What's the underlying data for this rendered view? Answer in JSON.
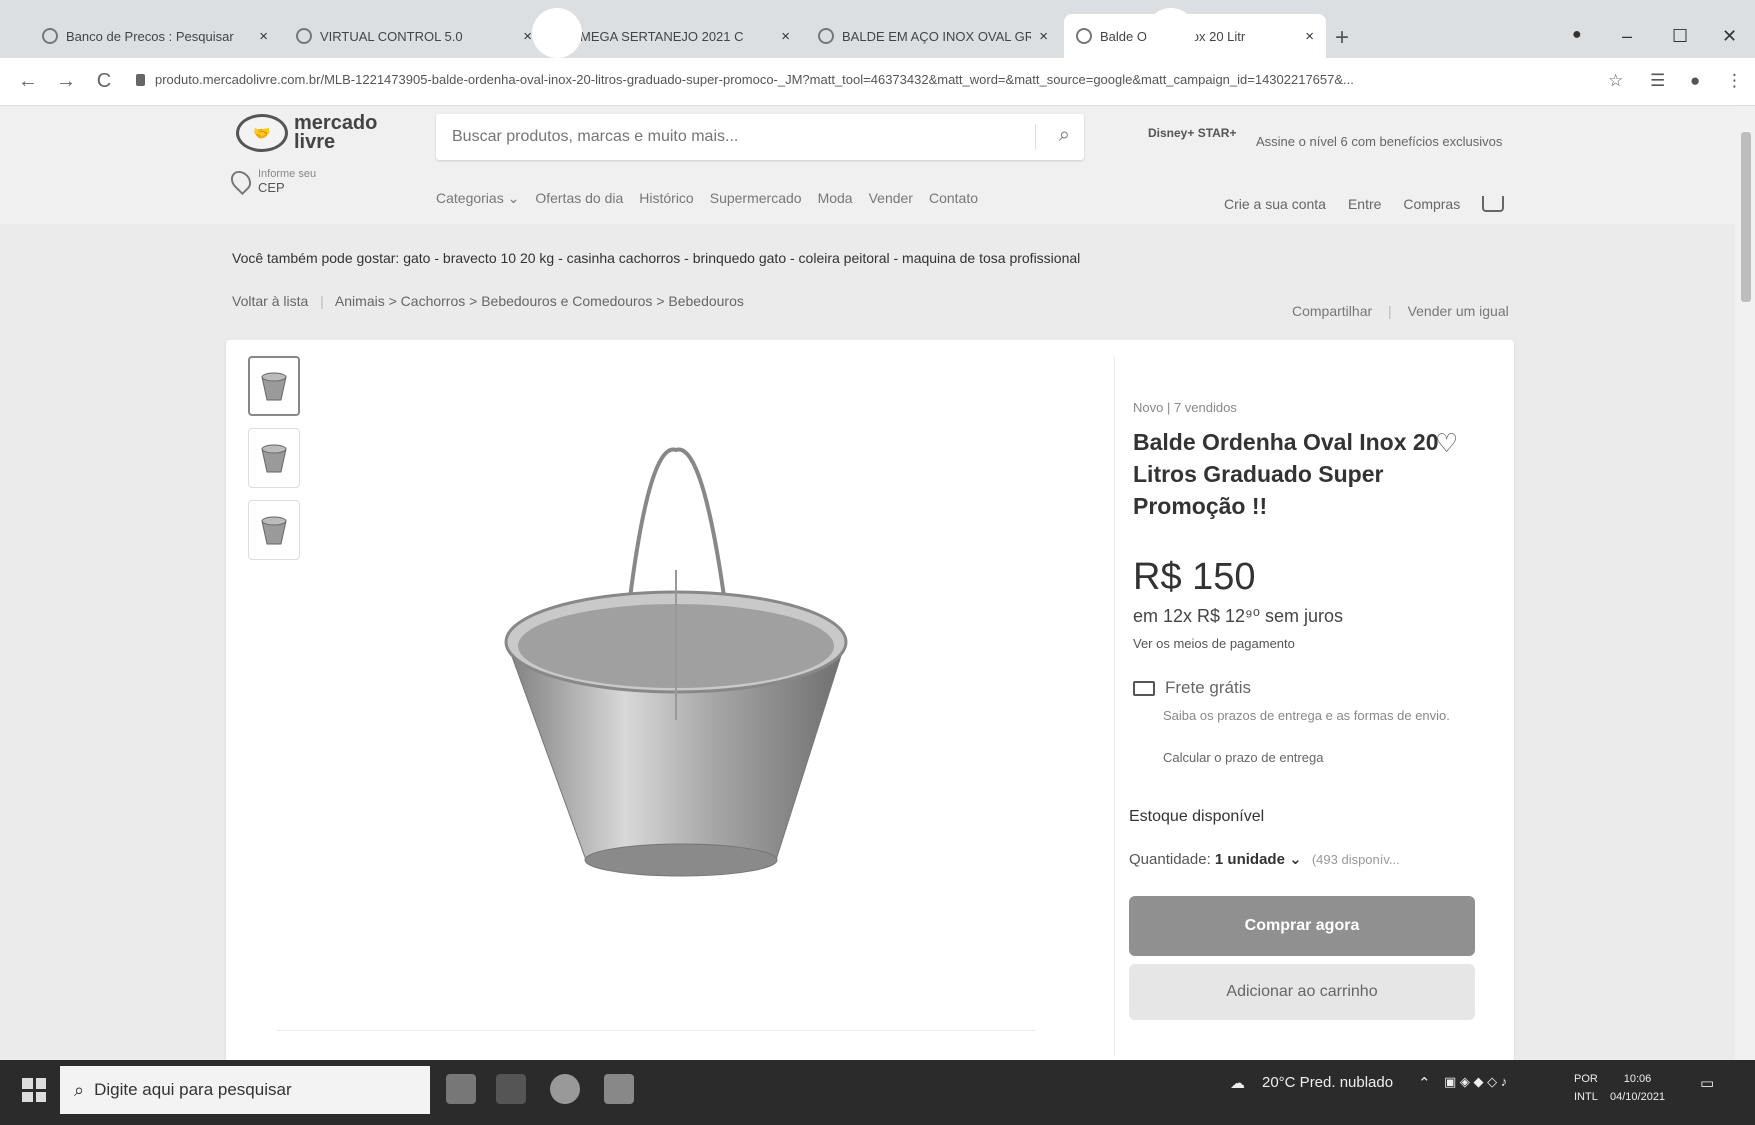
{
  "browser": {
    "tabs": [
      {
        "title": "Banco de Precos : Pesquisar",
        "close": "×"
      },
      {
        "title": "VIRTUAL CONTROL 5.0",
        "close": "×"
      },
      {
        "title": "MEGA SERTANEJO 2021 C",
        "close": "×"
      },
      {
        "title": "BALDE EM AÇO INOX OVAL GRA",
        "close": "×"
      },
      {
        "title": "Balde O    Oval Inox 20 Litr",
        "close": "×"
      }
    ],
    "new_tab": "+",
    "minimize": "–",
    "maximize": "☐",
    "close": "✕",
    "url": "produto.mercadolivre.com.br/MLB-1221473905-balde-ordenha-oval-inox-20-litros-graduado-super-promoco-_JM?matt_tool=46373432&matt_word=&matt_source=google&matt_campaign_id=14302217657&...",
    "back": "←",
    "forward": "→",
    "reload": "C",
    "star": "☆",
    "menu": "⋮"
  },
  "header": {
    "logo_text": "mercado livre",
    "search_placeholder": "Buscar produtos, marcas e muito mais...",
    "disney_badge": "Disney+ STAR+",
    "promo": "Assine o nível 6 com benefícios exclusivos",
    "cep_label": "Informe seu",
    "cep_value": "CEP",
    "nav": [
      "Categorias ⌄",
      "Ofertas do dia",
      "Histórico",
      "Supermercado",
      "Moda",
      "Vender",
      "Contato"
    ],
    "account": [
      "Crie a sua conta",
      "Entre",
      "Compras"
    ]
  },
  "suggestions": "Você também pode gostar: gato - bravecto 10 20 kg - casinha cachorros - brinquedo gato - coleira peitoral - maquina de tosa profissional",
  "breadcrumb": {
    "back": "Voltar à lista",
    "path": "Animais > Cachorros > Bebedouros e Comedouros > Bebedouros"
  },
  "share": {
    "share": "Compartilhar",
    "sell": "Vender um igual"
  },
  "product": {
    "condition": "Novo | 7 vendidos",
    "title": "Balde Ordenha Oval Inox 20 Litros Graduado Super Promoção !!",
    "price": "R$ 150",
    "installments": "em 12x R$ 12⁹⁰ sem juros",
    "payment_link": "Ver os meios de pagamento",
    "shipping_title": "Frete grátis",
    "shipping_desc": "Saiba os prazos de entrega e as formas de envio.",
    "shipping_calc": "Calcular o prazo de entrega",
    "stock": "Estoque disponível",
    "quantity_label": "Quantidade:",
    "quantity_value": "1 unidade ⌄",
    "quantity_available": "(493 disponív...",
    "buy_button": "Comprar agora",
    "cart_button": "Adicionar ao carrinho",
    "thumbnails": 3
  },
  "taskbar": {
    "search_placeholder": "Digite aqui para pesquisar",
    "weather": "20°C Pred. nublado",
    "lang": "POR",
    "lang2": "INTL",
    "time": "10:06",
    "date": "04/10/2021"
  }
}
